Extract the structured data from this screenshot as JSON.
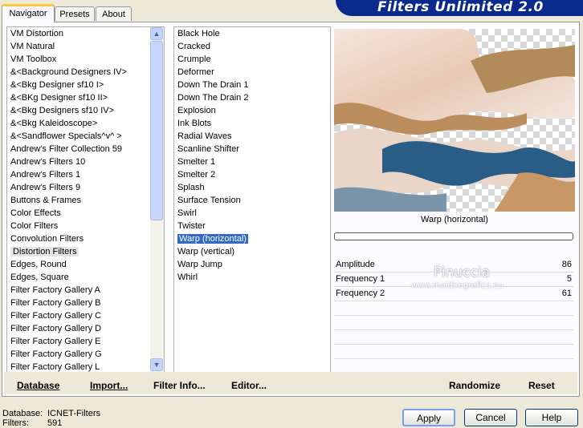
{
  "banner": {
    "title": "Filters Unlimited 2.0"
  },
  "tabs": [
    {
      "label": "Navigator",
      "active": true
    },
    {
      "label": "Presets",
      "active": false
    },
    {
      "label": "About",
      "active": false
    }
  ],
  "categories": {
    "items": [
      "VM Distortion",
      "VM Natural",
      "VM Toolbox",
      "&<Background Designers IV>",
      "&<Bkg Designer sf10 I>",
      "&<BKg Designer sf10 II>",
      "&<Bkg Designers sf10 IV>",
      "&<Bkg Kaleidoscope>",
      "&<Sandflower Specials^v^ >",
      "Andrew's Filter Collection 59",
      "Andrew's Filters 10",
      "Andrew's Filters 1",
      "Andrew's Filters 9",
      "Buttons & Frames",
      "Color Effects",
      "Color Filters",
      "Convolution Filters",
      "Distortion Filters",
      "Edges, Round",
      "Edges, Square",
      "Filter Factory Gallery A",
      "Filter Factory Gallery B",
      "Filter Factory Gallery C",
      "Filter Factory Gallery D",
      "Filter Factory Gallery E",
      "Filter Factory Gallery G",
      "Filter Factory Gallery L"
    ],
    "selected_index": 17
  },
  "filters": {
    "items": [
      "Black Hole",
      "Cracked",
      "Crumple",
      "Deformer",
      "Down The Drain 1",
      "Down The Drain 2",
      "Explosion",
      "Ink Blots",
      "Radial Waves",
      "Scanline Shifter",
      "Smelter 1",
      "Smelter 2",
      "Splash",
      "Surface Tension",
      "Swirl",
      "Twister",
      "Warp (horizontal)",
      "Warp (vertical)",
      "Warp Jump",
      "Whirl"
    ],
    "selected_index": 16
  },
  "preview": {
    "filter_name": "Warp (horizontal)",
    "watermark": "Pinuccia",
    "watermark_url": "www.maidiregrafica.eu",
    "progress": 0
  },
  "params": [
    {
      "label": "Amplitude",
      "value": "86"
    },
    {
      "label": "Frequency 1",
      "value": "5"
    },
    {
      "label": "Frequency 2",
      "value": "61"
    }
  ],
  "bottom": {
    "database": "Database",
    "import": "Import...",
    "filter_info": "Filter Info...",
    "editor": "Editor...",
    "randomize": "Randomize",
    "reset": "Reset"
  },
  "status": {
    "database_label": "Database:",
    "database_value": "ICNET-Filters",
    "filters_label": "Filters:",
    "filters_value": "591"
  },
  "buttons": {
    "apply": "Apply",
    "cancel": "Cancel",
    "help": "Help"
  }
}
